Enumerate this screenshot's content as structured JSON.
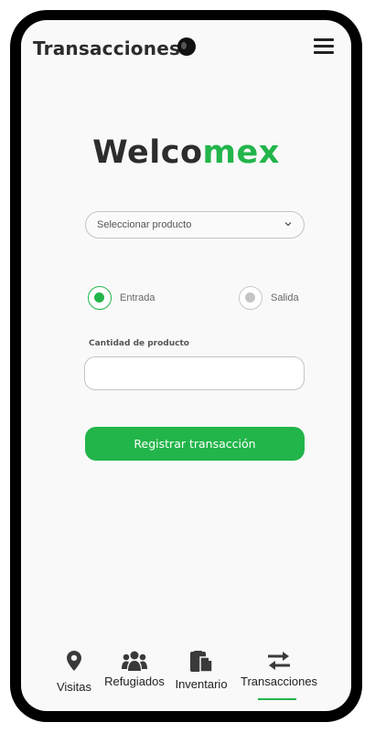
{
  "header": {
    "title": "Transacciones",
    "menu_icon": "hamburger-menu-icon"
  },
  "logo": {
    "part1": "Welco",
    "part2": "mex",
    "colors": {
      "dark": "#2d2d2d",
      "green": "#22b54a"
    }
  },
  "form": {
    "product_select": {
      "value": "Seleccionar producto",
      "icon": "chevron-down-icon"
    },
    "movement_type": {
      "options": [
        {
          "label": "Entrada",
          "selected": true
        },
        {
          "label": "Salida",
          "selected": false
        }
      ]
    },
    "quantity": {
      "label": "Cantidad de producto",
      "value": "",
      "placeholder": ""
    },
    "submit_label": "Registrar transacción"
  },
  "nav": {
    "items": [
      {
        "label": "Visitas",
        "icon": "map-pin-icon",
        "active": false
      },
      {
        "label": "Refugiados",
        "icon": "users-icon",
        "active": false
      },
      {
        "label": "Inventario",
        "icon": "inventory-icon",
        "active": false
      },
      {
        "label": "Transacciones",
        "icon": "transfer-arrows-icon",
        "active": true
      }
    ]
  },
  "colors": {
    "accent": "#22b54a",
    "background": "#f9f9f9",
    "frame": "#000000"
  }
}
